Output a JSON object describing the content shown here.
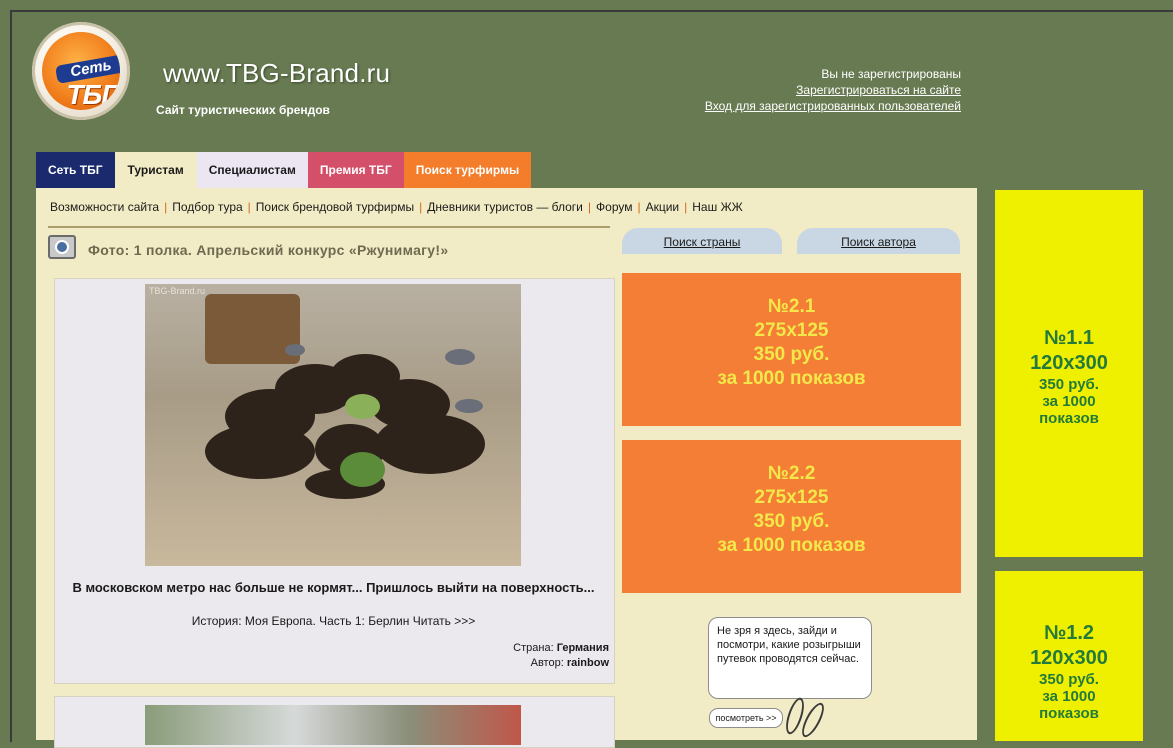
{
  "header": {
    "logo": {
      "top_text": "Сеть",
      "bottom_text": "ТБГ"
    },
    "site_title": "www.TBG-Brand.ru",
    "site_subtitle": "Сайт туристических брендов",
    "user": {
      "status": "Вы не зарегистрированы",
      "register_link": "Зарегистрироваться на сайте",
      "login_link": "Вход для зарегистрированных пользователей"
    }
  },
  "tabs": [
    "Сеть ТБГ",
    "Туристам",
    "Специалистам",
    "Премия ТБГ",
    "Поиск турфирмы"
  ],
  "subnav": [
    "Возможности сайта",
    "Подбор тура",
    "Поиск брендовой турфирмы",
    "Дневники туристов — блоги",
    "Форум",
    "Акции",
    "Наш ЖЖ"
  ],
  "photo_section": {
    "title": "Фото: 1 полка. Апрельский конкурс «Ржунимагу!»",
    "watermark": "TBG-Brand.ru",
    "caption": "В московском метро нас больше не кормят... Пришлось выйти на поверхность...",
    "history": "История: Моя Европа. Часть 1: Берлин Читать >>>",
    "country_label": "Страна:",
    "country": "Германия",
    "author_label": "Автор:",
    "author": "rainbow"
  },
  "search_tabs": [
    "Поиск страны",
    "Поиск автора"
  ],
  "ads_orange": [
    {
      "id": "№2.1",
      "size": "275x125",
      "price": "350 руб.",
      "terms": "за 1000 показов"
    },
    {
      "id": "№2.2",
      "size": "275x125",
      "price": "350 руб.",
      "terms": "за 1000 показов"
    }
  ],
  "promo": {
    "bubble_text": "Не зря я здесь, зайди и посмотри, какие розыгрыши путевок проводятся сейчас.",
    "button": "посмотреть >>"
  },
  "ads_yellow": [
    {
      "id": "№1.1",
      "size": "120x300",
      "price": "350 руб.",
      "terms1": "за 1000",
      "terms2": "показов"
    },
    {
      "id": "№1.2",
      "size": "120x300",
      "price": "350 руб.",
      "terms1": "за 1000",
      "terms2": "показов"
    }
  ],
  "colors": {
    "page_bg": "#687a52",
    "content_bg": "#f1ecc5",
    "tab1": "#1a2a6c",
    "tab4": "#d34f6a",
    "tab5": "#f37d2a",
    "orange_ad": "#f47e35",
    "yellow_ad": "#eef000"
  }
}
